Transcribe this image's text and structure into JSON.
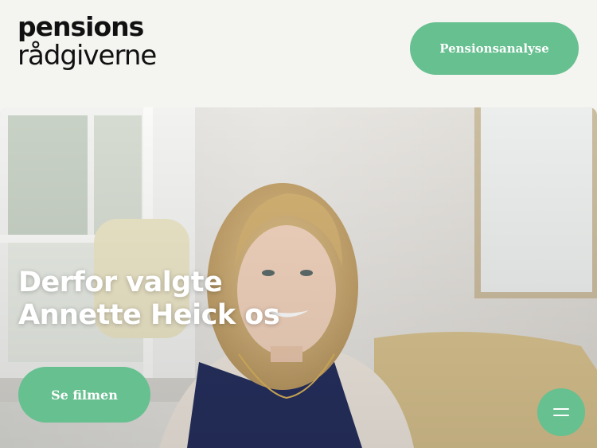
{
  "header": {
    "logo_line1": "pensions",
    "logo_line2": "rådgiverne",
    "cta_label": "Pensionsanalyse"
  },
  "hero": {
    "title_line1": "Derfor valgte",
    "title_line2": "Annette Heick os",
    "button_label": "Se filmen",
    "image_icon": "video-still-image"
  },
  "menu": {
    "icon": "hamburger-menu-icon"
  },
  "colors": {
    "accent": "#66c08f",
    "background": "#f4f4f0",
    "text_dark": "#111111",
    "text_light": "#ffffff"
  }
}
